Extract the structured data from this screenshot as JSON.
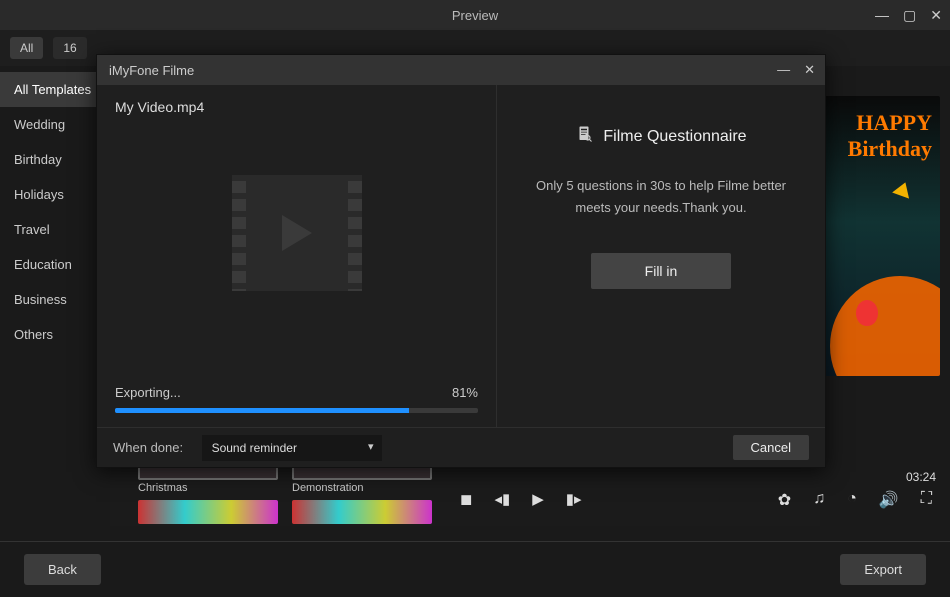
{
  "window": {
    "title": "Preview"
  },
  "filters": {
    "all": "All",
    "ratio": "16"
  },
  "sidebar": {
    "items": [
      {
        "label": "All Templates",
        "active": true
      },
      {
        "label": "Wedding",
        "active": false
      },
      {
        "label": "Birthday",
        "active": false
      },
      {
        "label": "Holidays",
        "active": false
      },
      {
        "label": "Travel",
        "active": false
      },
      {
        "label": "Education",
        "active": false
      },
      {
        "label": "Business",
        "active": false
      },
      {
        "label": "Others",
        "active": false
      }
    ]
  },
  "thumbnails": [
    {
      "caption": "Christmas"
    },
    {
      "caption": "Demonstration"
    }
  ],
  "preview": {
    "text1": "HAPPY",
    "text2": "Birthday",
    "time": "03:24"
  },
  "footer": {
    "back": "Back",
    "export": "Export"
  },
  "modal": {
    "title": "iMyFone Filme",
    "filename": "My Video.mp4",
    "export_label": "Exporting...",
    "export_percent_text": "81%",
    "export_percent_value": 81,
    "when_done_label": "When done:",
    "when_done_value": "Sound reminder",
    "cancel": "Cancel",
    "questionnaire": {
      "heading": "Filme Questionnaire",
      "desc": "Only 5 questions in 30s to help Filme better meets your needs.Thank you.",
      "button": "Fill in"
    }
  }
}
